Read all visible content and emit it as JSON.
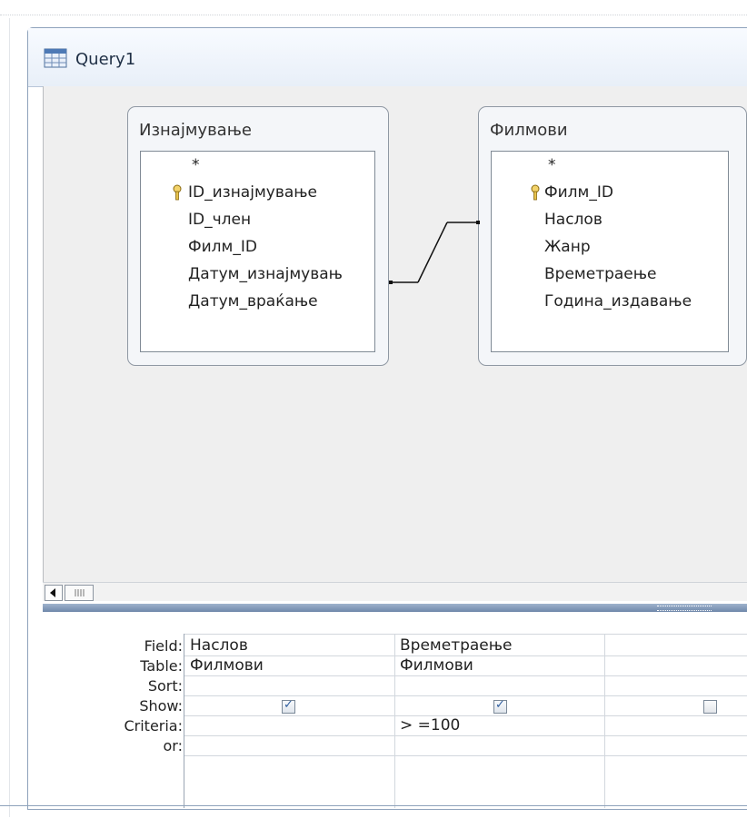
{
  "window": {
    "title": "Query1"
  },
  "tables": [
    {
      "name": "Изнајмување",
      "fields": [
        {
          "name": "*",
          "key": false
        },
        {
          "name": "ID_изнајмување",
          "key": true
        },
        {
          "name": "ID_член",
          "key": false
        },
        {
          "name": "Филм_ID",
          "key": false
        },
        {
          "name": "Датум_изнајмувањ",
          "key": false
        },
        {
          "name": "Датум_враќање",
          "key": false
        }
      ]
    },
    {
      "name": "Филмови",
      "fields": [
        {
          "name": "*",
          "key": false
        },
        {
          "name": "Филм_ID",
          "key": true
        },
        {
          "name": "Наслов",
          "key": false
        },
        {
          "name": "Жанр",
          "key": false
        },
        {
          "name": "Времетраење",
          "key": false
        },
        {
          "name": "Година_издавање",
          "key": false
        }
      ]
    }
  ],
  "grid": {
    "row_labels": {
      "field": "Field:",
      "table": "Table:",
      "sort": "Sort:",
      "show": "Show:",
      "criteria": "Criteria:",
      "or": "or:"
    },
    "columns": [
      {
        "field": "Наслов",
        "table": "Филмови",
        "sort": "",
        "show": true,
        "criteria": "",
        "or": ""
      },
      {
        "field": "Времетраење",
        "table": "Филмови",
        "sort": "",
        "show": true,
        "criteria": "> =100",
        "or": ""
      },
      {
        "field": "",
        "table": "",
        "sort": "",
        "show": false,
        "criteria": "",
        "or": ""
      }
    ]
  },
  "icons": {
    "title_icon": "query-icon",
    "key_icon": "primary-key-icon",
    "scroll_left": "arrow-left-icon"
  },
  "colors": {
    "splitter": "#7d93b2",
    "check_mark": "#2f5e9e"
  }
}
